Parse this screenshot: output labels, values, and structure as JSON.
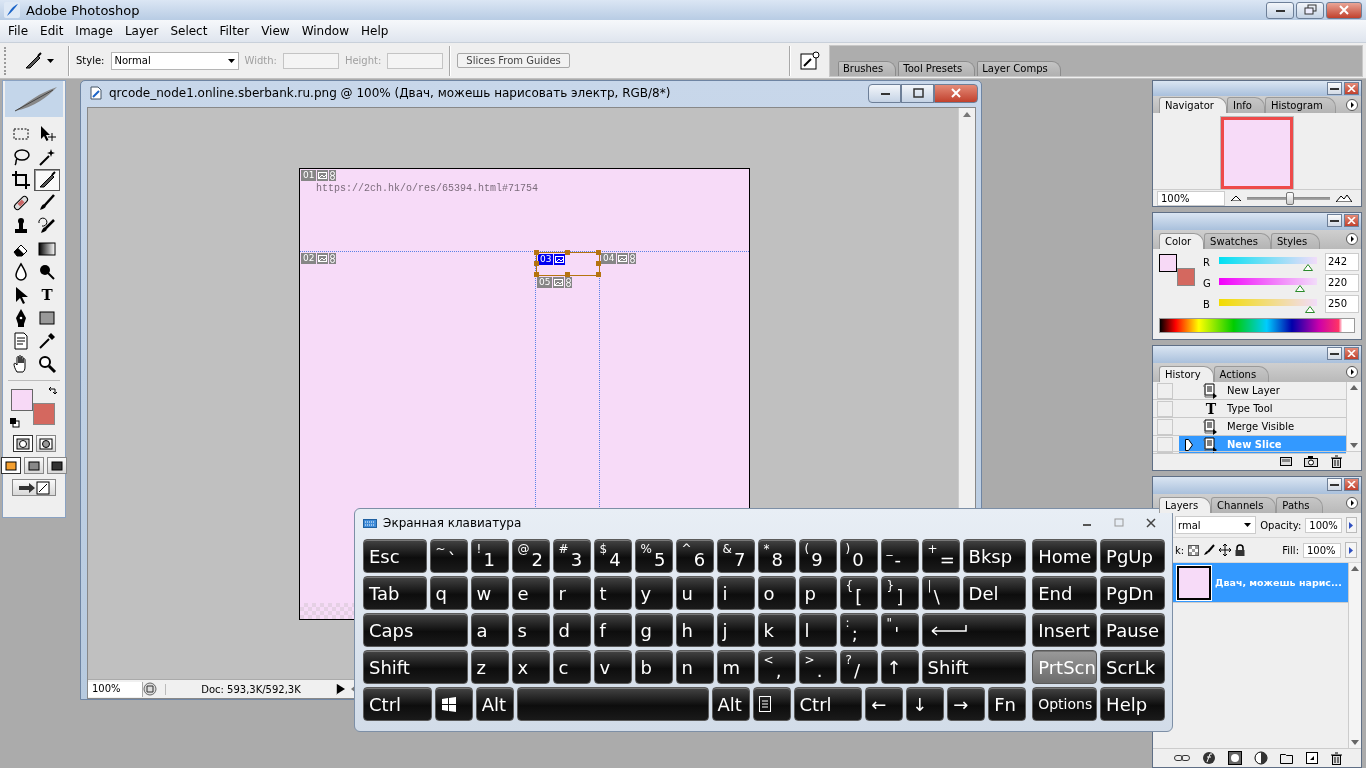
{
  "app": {
    "title": "Adobe Photoshop"
  },
  "menu": [
    "File",
    "Edit",
    "Image",
    "Layer",
    "Select",
    "Filter",
    "View",
    "Window",
    "Help"
  ],
  "options_bar": {
    "style_label": "Style:",
    "style_value": "Normal",
    "fields": [
      {
        "label": "Width:",
        "disabled": true
      },
      {
        "label": "Height:",
        "disabled": true
      }
    ],
    "button": "Slices From Guides",
    "palette_well": [
      "Brushes",
      "Tool Presets",
      "Layer Comps"
    ]
  },
  "toolbox": {
    "tools": [
      {
        "kind": "marquee",
        "selected": false
      },
      {
        "kind": "move",
        "selected": false
      },
      {
        "kind": "lasso",
        "selected": false
      },
      {
        "kind": "wand",
        "selected": false
      },
      {
        "kind": "crop",
        "selected": false
      },
      {
        "kind": "slice",
        "selected": true
      },
      {
        "kind": "healing",
        "selected": false
      },
      {
        "kind": "brush",
        "selected": false
      },
      {
        "kind": "stamp",
        "selected": false
      },
      {
        "kind": "history_brush",
        "selected": false
      },
      {
        "kind": "eraser",
        "selected": false
      },
      {
        "kind": "gradient",
        "selected": false
      },
      {
        "kind": "blur",
        "selected": false
      },
      {
        "kind": "dodge",
        "selected": false
      },
      {
        "kind": "path_select",
        "selected": false
      },
      {
        "kind": "type",
        "glyph": "T",
        "selected": false
      },
      {
        "kind": "pen",
        "selected": false
      },
      {
        "kind": "rect",
        "selected": false
      },
      {
        "kind": "notes",
        "selected": false
      },
      {
        "kind": "eyedropper",
        "selected": false
      },
      {
        "kind": "hand",
        "selected": false
      },
      {
        "kind": "zoom",
        "selected": false
      }
    ],
    "swatches": [
      {
        "kind": "foreground",
        "color": "#f7d9f6"
      },
      {
        "kind": "background",
        "color": "#d4685f"
      }
    ]
  },
  "document": {
    "title": "qrcode_node1.online.sberbank.ru.png @ 100% (Двач, можешь нарисовать электр, RGB/8*)",
    "text": "https://2ch.hk/o/res/65394.html#71754",
    "slices": [
      {
        "number": "01",
        "selected": false
      },
      {
        "number": "02",
        "selected": false
      },
      {
        "number": "03",
        "selected": true
      },
      {
        "number": "04",
        "selected": false
      },
      {
        "number": "05",
        "selected": false
      }
    ],
    "zoom": "100%",
    "doc_info": "Doc: 593,3K/592,3K"
  },
  "navigator": {
    "tabs": [
      {
        "label": "Navigator",
        "selected": true
      },
      {
        "label": "Info",
        "selected": false
      },
      {
        "label": "Histogram",
        "selected": false
      }
    ],
    "zoom": "100%",
    "level": 0.5
  },
  "color_panel": {
    "tabs": [
      {
        "label": "Color",
        "selected": true
      },
      {
        "label": "Swatches",
        "selected": false
      },
      {
        "label": "Styles",
        "selected": false
      }
    ],
    "swatches": [
      {
        "kind": "foreground",
        "color": "#f7d9f6"
      },
      {
        "kind": "background",
        "color": "#d4685f"
      }
    ],
    "channels": [
      {
        "name": "R",
        "value": "242",
        "level": 0.95
      },
      {
        "name": "G",
        "value": "220",
        "level": 0.86
      },
      {
        "name": "B",
        "value": "250",
        "level": 0.98
      }
    ]
  },
  "history": {
    "tabs": [
      {
        "label": "History",
        "selected": true
      },
      {
        "label": "Actions",
        "selected": false
      }
    ],
    "items": [
      {
        "label": "New Layer",
        "kind": "document",
        "selected": false
      },
      {
        "label": "Type Tool",
        "kind": "type",
        "glyph": "T",
        "selected": false
      },
      {
        "label": "Merge Visible",
        "kind": "document",
        "selected": false
      },
      {
        "label": "New Slice",
        "kind": "document",
        "selected": true
      }
    ]
  },
  "layers": {
    "tabs": [
      {
        "label": "Layers",
        "selected": true
      },
      {
        "label": "Channels",
        "selected": false
      },
      {
        "label": "Paths",
        "selected": false
      }
    ],
    "blend_mode": "rmal",
    "opacity_label": "Opacity:",
    "opacity": "100%",
    "lock_label": "k:",
    "fill_label": "Fill:",
    "fill": "100%",
    "items": [
      {
        "name": "Двач, можешь нарис...",
        "selected": true
      }
    ]
  },
  "keyboard": {
    "title": "Экранная клавиатура",
    "rows": [
      {
        "keys": [
          {
            "label": "Esc",
            "kind": "wide"
          },
          {
            "shift": "~",
            "label": "`"
          },
          {
            "shift": "!",
            "label": "1"
          },
          {
            "shift": "@",
            "label": "2"
          },
          {
            "shift": "#",
            "label": "3"
          },
          {
            "shift": "$",
            "label": "4"
          },
          {
            "shift": "%",
            "label": "5"
          },
          {
            "shift": "^",
            "label": "6"
          },
          {
            "shift": "&",
            "label": "7"
          },
          {
            "shift": "*",
            "label": "8"
          },
          {
            "shift": "(",
            "label": "9"
          },
          {
            "shift": ")",
            "label": "0"
          },
          {
            "shift": "_",
            "label": "-"
          },
          {
            "shift": "+",
            "label": "="
          },
          {
            "label": "Bksp",
            "kind": "wide"
          }
        ]
      },
      {
        "keys": [
          {
            "label": "Tab",
            "kind": "wide"
          },
          {
            "label": "q"
          },
          {
            "label": "w"
          },
          {
            "label": "e"
          },
          {
            "label": "r"
          },
          {
            "label": "t"
          },
          {
            "label": "y"
          },
          {
            "label": "u"
          },
          {
            "label": "i"
          },
          {
            "label": "o"
          },
          {
            "label": "p"
          },
          {
            "shift": "{",
            "label": "["
          },
          {
            "shift": "}",
            "label": "]"
          },
          {
            "shift": "|",
            "label": "\\"
          },
          {
            "label": "Del",
            "kind": "wide"
          }
        ]
      },
      {
        "keys": [
          {
            "label": "Caps",
            "kind": "wide"
          },
          {
            "label": "a"
          },
          {
            "label": "s"
          },
          {
            "label": "d"
          },
          {
            "label": "f"
          },
          {
            "label": "g"
          },
          {
            "label": "h"
          },
          {
            "label": "j"
          },
          {
            "label": "k"
          },
          {
            "label": "l"
          },
          {
            "shift": ":",
            "label": ";"
          },
          {
            "shift": "\"",
            "label": "'"
          },
          {
            "kind": "enter"
          }
        ]
      },
      {
        "keys": [
          {
            "label": "Shift",
            "kind": "wide"
          },
          {
            "label": "z"
          },
          {
            "label": "x"
          },
          {
            "label": "c"
          },
          {
            "label": "v"
          },
          {
            "label": "b"
          },
          {
            "label": "n"
          },
          {
            "label": "m"
          },
          {
            "shift": "<",
            "label": ","
          },
          {
            "shift": ">",
            "label": "."
          },
          {
            "shift": "?",
            "label": "/"
          },
          {
            "label": "↑"
          },
          {
            "label": "Shift",
            "kind": "wide"
          }
        ]
      },
      {
        "keys": [
          {
            "label": "Ctrl",
            "kind": "wide"
          },
          {
            "kind": "windows"
          },
          {
            "label": "Alt"
          },
          {
            "kind": "space"
          },
          {
            "label": "Alt"
          },
          {
            "kind": "menu"
          },
          {
            "label": "Ctrl",
            "kind": "wide"
          },
          {
            "label": "←"
          },
          {
            "label": "↓"
          },
          {
            "label": "→"
          },
          {
            "label": "Fn"
          }
        ]
      }
    ],
    "side_rows": [
      [
        {
          "label": "Home",
          "pressed": false
        },
        {
          "label": "PgUp",
          "pressed": false
        }
      ],
      [
        {
          "label": "End",
          "pressed": false
        },
        {
          "label": "PgDn",
          "pressed": false
        }
      ],
      [
        {
          "label": "Insert",
          "pressed": false
        },
        {
          "label": "Pause",
          "pressed": false
        }
      ],
      [
        {
          "label": "PrtScn",
          "pressed": true
        },
        {
          "label": "ScrLk",
          "pressed": false
        }
      ],
      [
        {
          "label": "Options",
          "pressed": false,
          "kind": "small"
        },
        {
          "label": "Help",
          "pressed": false
        }
      ]
    ]
  }
}
